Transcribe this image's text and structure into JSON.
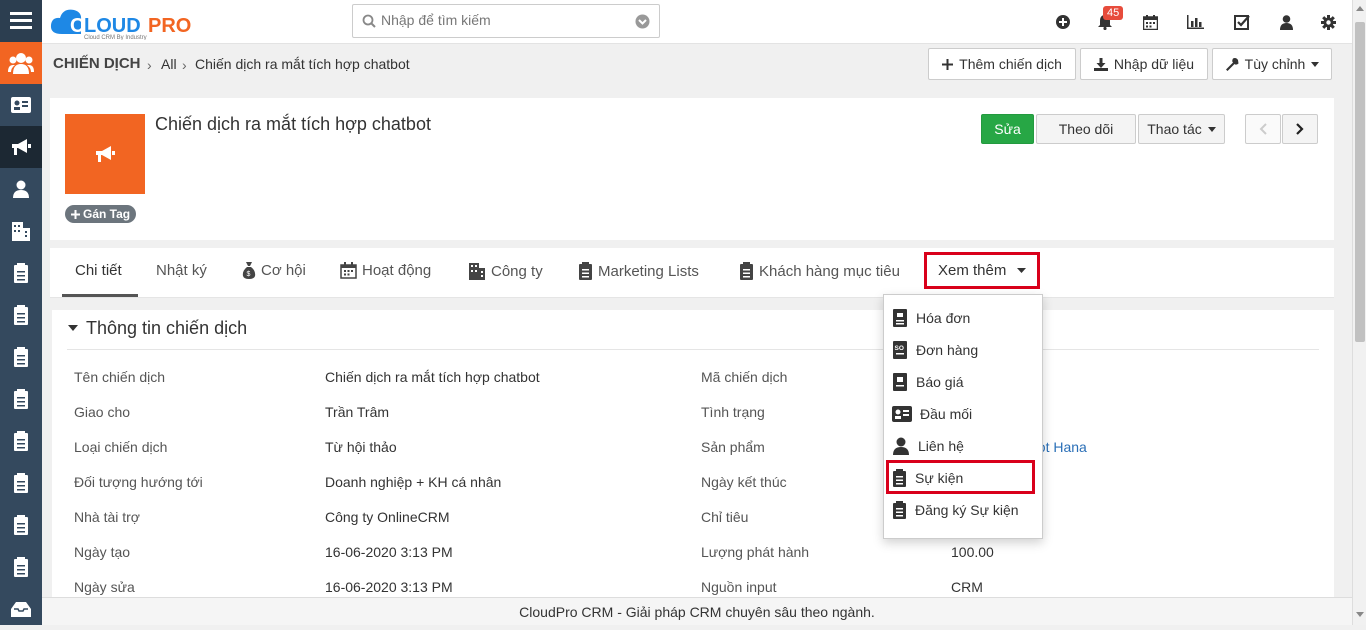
{
  "app": {
    "logo_text": "CLOUDPRO",
    "logo_tagline": "Cloud CRM By Industry"
  },
  "search": {
    "placeholder": "Nhập để tìm kiếm"
  },
  "topbar": {
    "notification_count": "45"
  },
  "breadcrumb": {
    "module": "CHIẾN DỊCH",
    "filter": "All",
    "record": "Chiến dịch ra mắt tích hợp chatbot"
  },
  "header_buttons": {
    "add": "Thêm chiến dịch",
    "import": "Nhập dữ liệu",
    "customize": "Tùy chỉnh"
  },
  "record": {
    "title": "Chiến dịch ra mắt tích hợp chatbot",
    "tag_label": "Gán Tag",
    "edit": "Sửa",
    "follow": "Theo dõi",
    "actions": "Thao tác"
  },
  "tabs": [
    "Chi tiết",
    "Nhật ký",
    "Cơ hội",
    "Hoạt động",
    "Công ty",
    "Marketing Lists",
    "Khách hàng mục tiêu",
    "Xem thêm"
  ],
  "section": {
    "title": "Thông tin chiến dịch"
  },
  "fields_left": [
    {
      "label": "Tên chiến dịch",
      "value": "Chiến dịch ra mắt tích hợp chatbot"
    },
    {
      "label": "Giao cho",
      "value": "Trần Trâm"
    },
    {
      "label": "Loại chiến dịch",
      "value": "Từ hội thảo"
    },
    {
      "label": "Đối tượng hướng tới",
      "value": "Doanh nghiệp + KH cá nhân"
    },
    {
      "label": "Nhà tài trợ",
      "value": "Công ty OnlineCRM"
    },
    {
      "label": "Ngày tạo",
      "value": "16-06-2020 3:13 PM"
    },
    {
      "label": "Ngày sửa",
      "value": "16-06-2020 3:13 PM"
    }
  ],
  "fields_right": [
    {
      "label": "Mã chiến dịch",
      "value": ""
    },
    {
      "label": "Tình trạng",
      "value": ""
    },
    {
      "label": "Sản phẩm",
      "value": "bot Hana"
    },
    {
      "label": "Ngày kết thúc",
      "value": ""
    },
    {
      "label": "Chỉ tiêu",
      "value": ""
    },
    {
      "label": "Lượng phát hành",
      "value": "100.00"
    },
    {
      "label": "Nguồn input",
      "value": "CRM"
    }
  ],
  "more_menu": [
    "Hóa đơn",
    "Đơn hàng",
    "Báo giá",
    "Đầu mối",
    "Liên hệ",
    "Sự kiện",
    "Đăng ký Sự kiện"
  ],
  "footer": {
    "text": "CloudPro CRM - Giải pháp CRM chuyên sâu theo ngành."
  },
  "colors": {
    "sidebar": "#34495e",
    "accent_orange": "#f26522",
    "edit_green": "#27a745",
    "highlight_red": "#d9001b",
    "logo_blue": "#1e88e5"
  }
}
